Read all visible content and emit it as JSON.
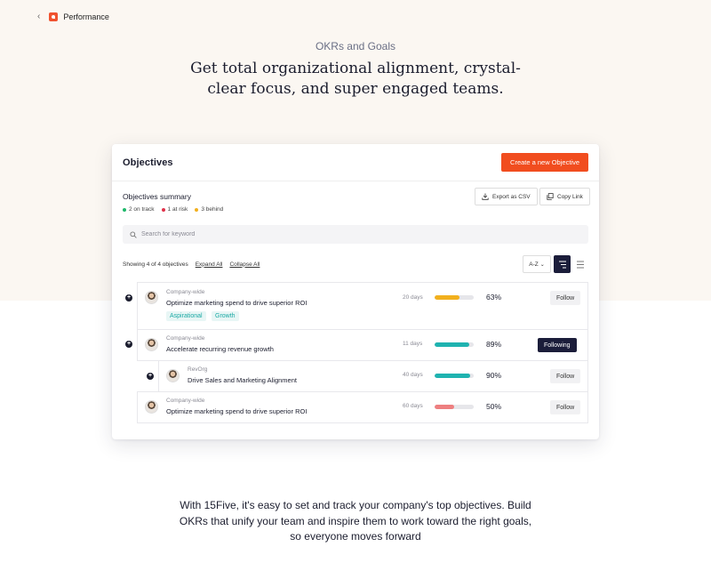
{
  "nav": {
    "back_icon": "chevron-left",
    "brand_icon": "15five-logo",
    "label": "Performance"
  },
  "hero": {
    "eyebrow": "OKRs and Goals",
    "headline": "Get total organizational alignment, crystal-clear focus, and super engaged teams."
  },
  "panel": {
    "title": "Objectives",
    "create_button": "Create a new Objective",
    "summary_title": "Objectives summary",
    "statuses": [
      {
        "label": "2 on track",
        "color": "#1fb86a"
      },
      {
        "label": "1 at risk",
        "color": "#e0324a"
      },
      {
        "label": "3 behind",
        "color": "#f2b01e"
      }
    ],
    "export_button": "Export as CSV",
    "copy_button": "Copy Link",
    "search_placeholder": "Search for keyword",
    "showing": "Showing 4 of 4 objectives",
    "expand_all": "Expand All",
    "collapse_all": "Collapse All",
    "sort": "A-Z"
  },
  "objectives": [
    {
      "group": "Company-wide",
      "name": "Optimize marketing spend to drive superior ROI",
      "tags": [
        "Aspirational",
        "Growth"
      ],
      "days": "20 days",
      "progress": 0.63,
      "percent": "63%",
      "bar_color": "#f2b01e",
      "follow": "Follow",
      "following": false
    },
    {
      "group": "Company-wide",
      "name": "Accelerate recurring revenue growth",
      "tags": [],
      "days": "11 days",
      "progress": 0.89,
      "percent": "89%",
      "bar_color": "#1fb3b0",
      "follow": "Following",
      "following": true
    },
    {
      "group": "RevOrg",
      "name": "Drive Sales and Marketing Alignment",
      "tags": [],
      "days": "40 days",
      "progress": 0.9,
      "percent": "90%",
      "bar_color": "#1fb3b0",
      "follow": "Follow",
      "following": false
    },
    {
      "group": "Company-wide",
      "name": "Optimize marketing spend to drive superior ROI",
      "tags": [],
      "days": "60 days",
      "progress": 0.5,
      "percent": "50%",
      "bar_color": "#ee7f80",
      "follow": "Follow",
      "following": false
    }
  ],
  "body_copy": "With 15Five, it's easy to set and track your company's top objectives. Build OKRs that unify your team and inspire them to work toward the right goals, so everyone moves forward"
}
